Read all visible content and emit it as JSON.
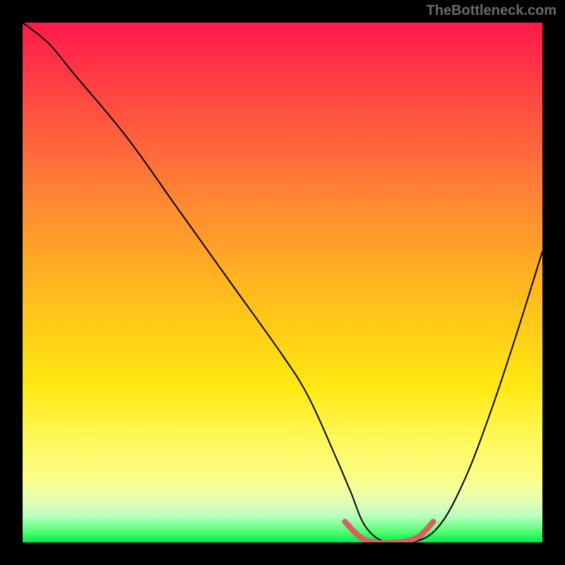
{
  "watermark": "TheBottleneck.com",
  "chart_data": {
    "type": "line",
    "title": "",
    "xlabel": "",
    "ylabel": "",
    "xlim": [
      0,
      100
    ],
    "ylim": [
      0,
      100
    ],
    "background_gradient": {
      "direction": "vertical",
      "stops": [
        {
          "pos": 0,
          "color": "#ff1a4a"
        },
        {
          "pos": 0.5,
          "color": "#ffc31a"
        },
        {
          "pos": 0.85,
          "color": "#fff85a"
        },
        {
          "pos": 1.0,
          "color": "#00e850"
        }
      ]
    },
    "series": [
      {
        "name": "bottleneck-curve",
        "x": [
          0,
          5,
          10,
          20,
          30,
          40,
          50,
          55,
          60,
          63,
          66,
          70,
          75,
          80,
          85,
          90,
          95,
          100
        ],
        "y": [
          100,
          96,
          90,
          78,
          64,
          50,
          36,
          28,
          17,
          10,
          3,
          0,
          0,
          3,
          12,
          25,
          40,
          56
        ],
        "color": "#000000"
      }
    ],
    "highlight": {
      "name": "minimum-band",
      "x": [
        62,
        65,
        68,
        72,
        76,
        79
      ],
      "y": [
        4,
        1,
        0,
        0,
        1,
        4
      ],
      "color": "#d86060"
    }
  }
}
